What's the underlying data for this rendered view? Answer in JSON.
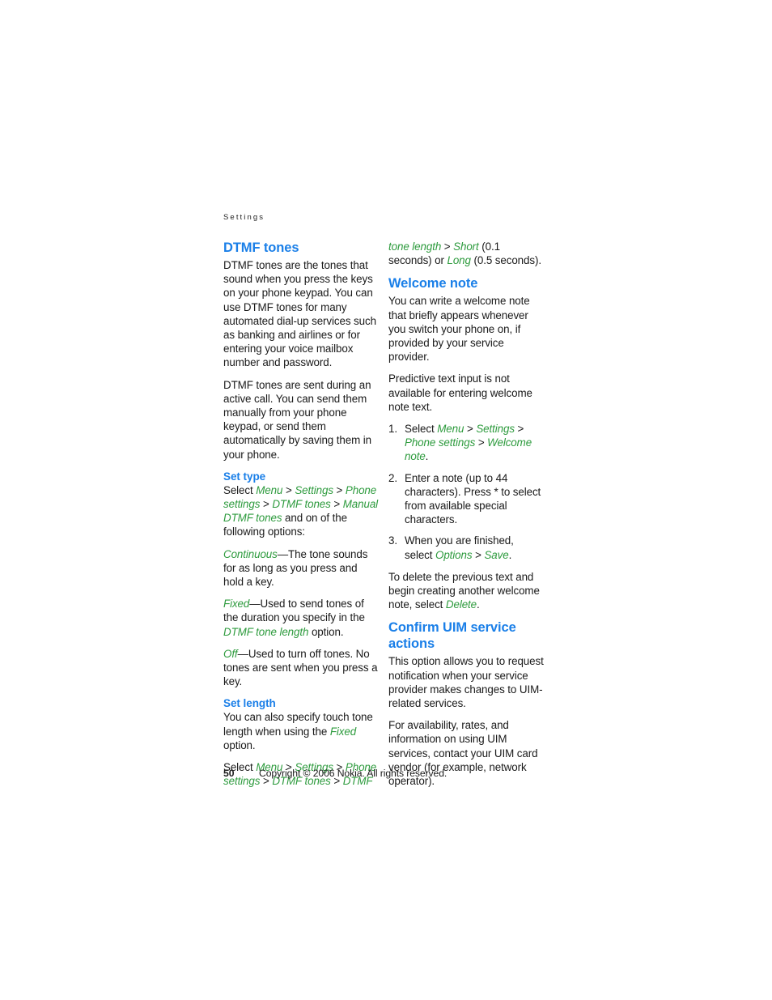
{
  "page": {
    "running_header": "Settings",
    "page_number": "50",
    "copyright": "Copyright © 2006 Nokia. All rights reserved.",
    "accent_blue": "#1a7fe8",
    "menu_green": "#2e9b3e",
    "body_color": "#1a1a1a",
    "background": "#ffffff"
  },
  "left_column": {
    "section_heading": "DTMF tones",
    "para_1": "DTMF tones are the tones that sound when you press the keys on your phone keypad. You can use DTMF tones for many automated dial-up services such as banking and airlines or for entering your voice mailbox number and password.",
    "para_2": "DTMF tones are sent during an active call. You can send them manually from your phone keypad, or send them automatically by saving them in your phone.",
    "set_type": {
      "heading": "Set type",
      "select_label": "Select ",
      "path": [
        "Menu",
        "Settings",
        "Phone settings",
        "DTMF tones",
        "Manual DTMF tones"
      ],
      "path_tail": " and on of the following options:",
      "options": [
        {
          "term": "Continuous",
          "definition": "—The tone sounds for as long as you press and hold a key."
        },
        {
          "term": "Fixed",
          "definition_part_1": "—Used to send tones of the duration you specify in the ",
          "emphasis": "DTMF tone length",
          "definition_part_2": " option."
        },
        {
          "term": "Off",
          "definition": "—Used to turn off tones. No tones are sent when you press a key."
        }
      ]
    },
    "set_length": {
      "heading": "Set length",
      "para_1_part_1": "You can also specify touch tone length when using the ",
      "para_1_emphasis": "Fixed",
      "para_1_part_2": " option.",
      "select_label": "Select ",
      "path": [
        "Menu",
        "Settings",
        "Phone settings",
        "DTMF tones",
        "DTMF"
      ]
    }
  },
  "right_column": {
    "continued_path": [
      "tone length",
      "Short"
    ],
    "continued_text_1": " (0.1 seconds) or ",
    "continued_emphasis": "Long",
    "continued_text_2": " (0.5 seconds).",
    "welcome_note": {
      "heading": "Welcome note",
      "para_1": "You can write a welcome note that briefly appears whenever you switch your phone on, if provided by your service provider.",
      "para_2": "Predictive text input is not available for entering welcome note text.",
      "steps": [
        {
          "lead": "Select ",
          "path": [
            "Menu",
            "Settings",
            "Phone settings",
            "Welcome note"
          ],
          "tail": "."
        },
        {
          "text": "Enter a note (up to 44 characters). Press * to select from available special characters."
        },
        {
          "lead": "When you are finished, select ",
          "path": [
            "Options",
            "Save"
          ],
          "tail": "."
        }
      ],
      "closing_part_1": "To delete the previous text and begin creating another welcome note, select ",
      "closing_emphasis": "Delete",
      "closing_part_2": "."
    },
    "confirm_uim": {
      "heading": "Confirm UIM service actions",
      "para_1": "This option allows you to request notification when your service provider makes changes to UIM-related services.",
      "para_2": "For availability, rates, and information on using UIM services, contact your UIM card vendor (for example, network operator)."
    }
  }
}
